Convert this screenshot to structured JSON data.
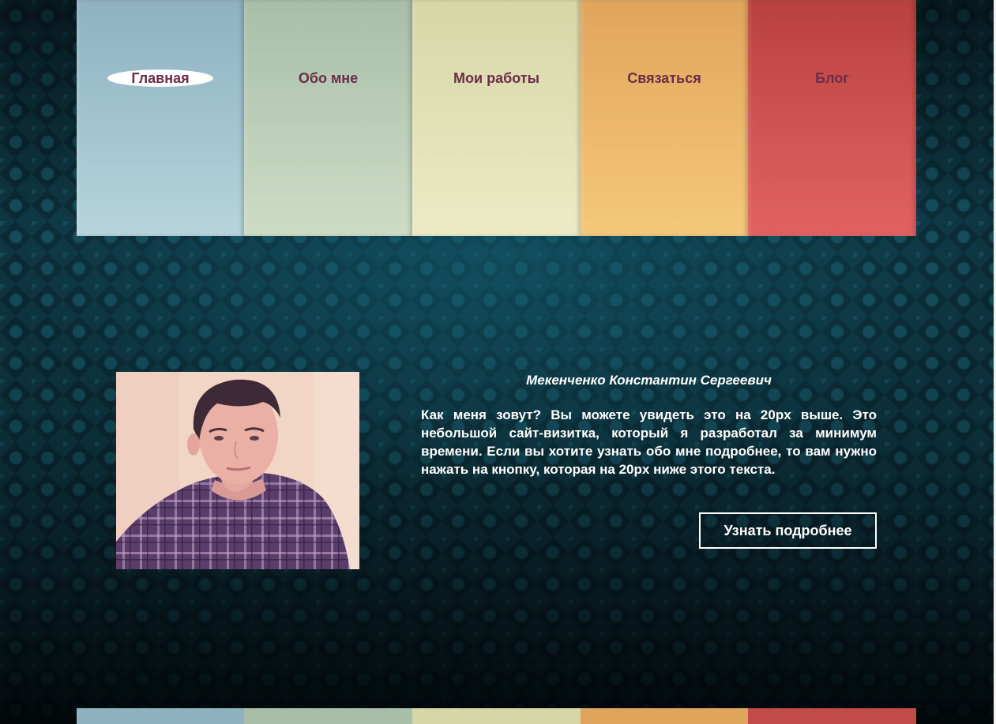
{
  "nav": {
    "items": [
      {
        "label": "Главная",
        "active": true,
        "color": "#a3c4d0"
      },
      {
        "label": "Обо мне",
        "active": false,
        "color": "#bccfb8"
      },
      {
        "label": "Мои работы",
        "active": false,
        "color": "#e2e2b8"
      },
      {
        "label": "Связаться",
        "active": false,
        "color": "#ecb86c"
      },
      {
        "label": "Блог",
        "active": false,
        "color": "#cf5554"
      }
    ],
    "label_color": "#6b2d48"
  },
  "profile": {
    "photo_icon": "portrait-photo",
    "name": "Мекенченко Константин Сергеевич",
    "text": "Как меня зовут? Вы можете увидеть это на 20px выше. Это небольшой сайт-визитка, который я разработал за минимум времени. Если вы хотите узнать обо мне подробнее, то вам нужно нажать на кнопку, которая на 20px ниже этого текста.",
    "button_label": "Узнать подробнее"
  },
  "theme": {
    "background": "#0b2a35",
    "text_color": "#ffffff"
  }
}
